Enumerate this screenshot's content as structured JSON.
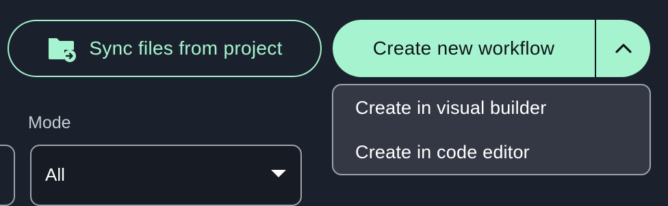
{
  "toolbar": {
    "sync_label": "Sync files from project",
    "sync_icon": "folder-sync-icon",
    "create_label": "Create new workflow",
    "create_toggle_icon": "chevron-up-icon"
  },
  "create_menu": {
    "items": [
      {
        "label": "Create in visual builder"
      },
      {
        "label": "Create in code editor"
      }
    ]
  },
  "filters": {
    "mode": {
      "label": "Mode",
      "value": "All",
      "icon": "caret-down-icon"
    }
  },
  "colors": {
    "background": "#1b212c",
    "accent": "#a6f4cf",
    "menu_bg": "#343844",
    "border": "#9ea3ad"
  }
}
